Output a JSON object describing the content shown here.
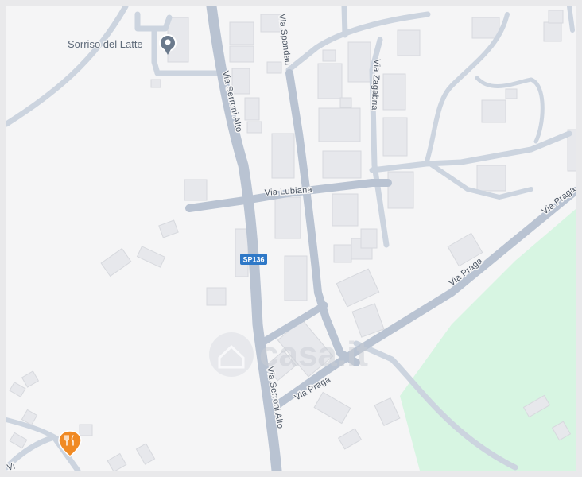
{
  "map": {
    "poi": {
      "name": "Sorriso del Latte",
      "icon": "location-pin-icon"
    },
    "restaurant": {
      "icon": "restaurant-fork-knife-icon",
      "color": "#f08a24"
    },
    "streets": {
      "serroni_alto_top": "Via Serroni Alto",
      "serroni_alto_bottom": "Via Serroni Alto",
      "spandau": "Via Spandau",
      "zagabria": "Via Zagabria",
      "lubiana": "Via Lubiana",
      "praga_upper": "Via Praga",
      "praga_lower": "Via Praga",
      "corner_fragment": "Vi"
    },
    "road_shield": {
      "label": "SP136",
      "color": "#2e78c7"
    },
    "watermark": {
      "text": "casa.it",
      "icon": "house-icon"
    },
    "colors": {
      "background": "#f5f5f6",
      "park": "#d7f5e2",
      "road": "#ccd4df",
      "building": "#e7e8ec"
    }
  }
}
